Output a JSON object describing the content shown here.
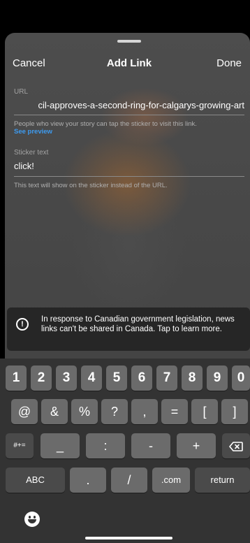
{
  "header": {
    "cancel": "Cancel",
    "title": "Add Link",
    "done": "Done"
  },
  "url": {
    "label": "URL",
    "value": "cil-approves-a-second-ring-for-calgarys-growing-art",
    "help": "People who view your story can tap the sticker to visit this link.",
    "preview": "See preview"
  },
  "sticker": {
    "label": "Sticker text",
    "value": "click!",
    "help": "This text will show on the sticker instead of the URL."
  },
  "notice": {
    "text": "In response to Canadian government legislation, news links can't be shared in Canada. Tap to learn more."
  },
  "keyboard": {
    "row1": [
      "1",
      "2",
      "3",
      "4",
      "5",
      "6",
      "7",
      "8",
      "9",
      "0"
    ],
    "row2": [
      "@",
      "&",
      "%",
      "?",
      ",",
      "=",
      "[",
      "]"
    ],
    "row3": [
      "#+=",
      "_",
      ":",
      "-",
      "+"
    ],
    "row4": [
      "ABC",
      ".",
      "/",
      ".com",
      "return"
    ]
  }
}
